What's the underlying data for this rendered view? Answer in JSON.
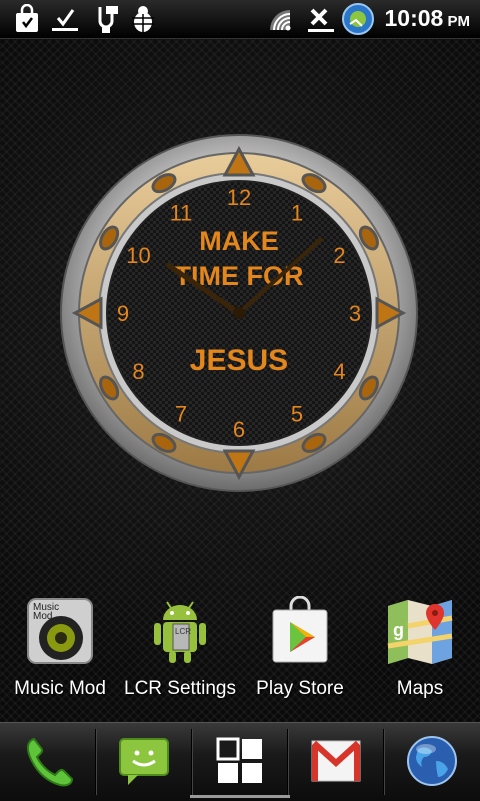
{
  "status_bar": {
    "icons_left": [
      "shopping-bag-notification-icon",
      "download-complete-icon",
      "usb-debug-icon",
      "bug-icon"
    ],
    "icons_right": [
      "wifi-icon",
      "no-signal-icon",
      "sync-app-icon"
    ],
    "time": "10:08",
    "ampm": "PM"
  },
  "clock_widget": {
    "text_line1": "MAKE",
    "text_line2": "TIME FOR",
    "text_line3": "JESUS",
    "numerals": [
      "12",
      "1",
      "2",
      "3",
      "4",
      "5",
      "6",
      "7",
      "8",
      "9",
      "10",
      "11"
    ],
    "hour_hand_time": "10:08",
    "accent_color": "#e3861c"
  },
  "apps": [
    {
      "label": "Music Mod",
      "icon": "music-mod-speaker-icon"
    },
    {
      "label": "LCR Settings",
      "icon": "android-lcr-icon"
    },
    {
      "label": "Play Store",
      "icon": "play-store-icon"
    },
    {
      "label": "Maps",
      "icon": "maps-icon"
    }
  ],
  "dock": [
    {
      "icon": "phone-icon"
    },
    {
      "icon": "messaging-icon"
    },
    {
      "icon": "app-drawer-icon"
    },
    {
      "icon": "gmail-icon"
    },
    {
      "icon": "browser-globe-icon"
    }
  ],
  "colors": {
    "accent": "#e3861c",
    "status_bar": "#000000"
  }
}
